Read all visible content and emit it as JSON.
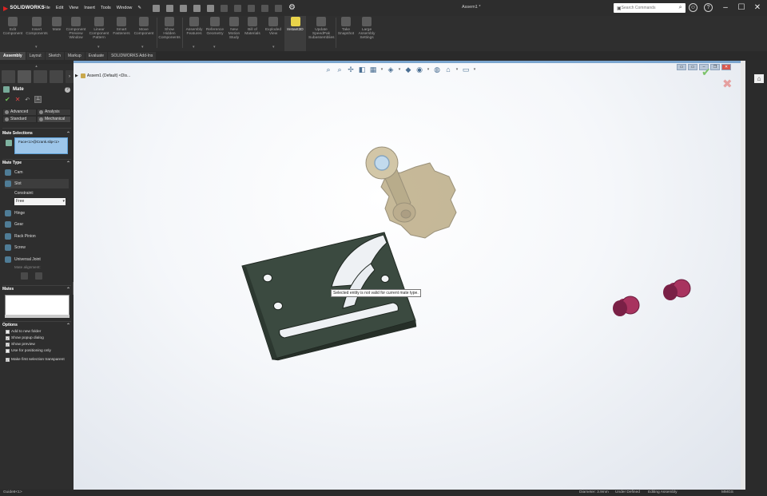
{
  "app": {
    "logo": "SOLIDWORKS",
    "document_title": "Assem1 *"
  },
  "menu": [
    "File",
    "Edit",
    "View",
    "Insert",
    "Tools",
    "Window"
  ],
  "search": {
    "placeholder": "Search Commands"
  },
  "ribbon": [
    {
      "id": "edit-component",
      "label": "Edit Component"
    },
    {
      "id": "insert-components",
      "label": "Insert Components"
    },
    {
      "id": "mate",
      "label": "Mate"
    },
    {
      "id": "component-preview",
      "label": "Component Preview Window"
    },
    {
      "id": "linear-pattern",
      "label": "Linear Component Pattern"
    },
    {
      "id": "smart-fasteners",
      "label": "Smart Fasteners"
    },
    {
      "id": "move-component",
      "label": "Move Component"
    },
    {
      "id": "show-hidden",
      "label": "Show Hidden Components"
    },
    {
      "id": "assembly-features",
      "label": "Assembly Features"
    },
    {
      "id": "reference-geometry",
      "label": "Reference Geometry"
    },
    {
      "id": "new-motion-study",
      "label": "New Motion Study"
    },
    {
      "id": "bill-of-materials",
      "label": "Bill of Materials"
    },
    {
      "id": "exploded-view",
      "label": "Exploded View"
    },
    {
      "id": "instant3d",
      "label": "Instant3D"
    },
    {
      "id": "update-speedpak",
      "label": "Update SpeedPak Subassemblies"
    },
    {
      "id": "take-snapshot",
      "label": "Take Snapshot"
    },
    {
      "id": "large-assembly",
      "label": "Large Assembly Settings"
    }
  ],
  "tabs": [
    "Assembly",
    "Layout",
    "Sketch",
    "Markup",
    "Evaluate",
    "SOLIDWORKS Add-Ins"
  ],
  "pm": {
    "title": "Mate",
    "help": "?",
    "subtabs": [
      "Advanced",
      "Analysis",
      "Standard",
      "Mechanical"
    ],
    "mate_selections_title": "Mate Selections",
    "selection": "Face<1>@Crank.slip<1>",
    "mate_type_title": "Mate Type",
    "mate_types": [
      "Cam",
      "Slot",
      "Hinge",
      "Gear",
      "Rack Pinion",
      "Screw",
      "Universal Joint"
    ],
    "constraint_label": "Constraint:",
    "constraint_value": "Free",
    "mate_alignment_label": "Mate alignment:",
    "mates_title": "Mates",
    "options_title": "Options",
    "options": [
      {
        "label": "Add to new folder",
        "checked": false
      },
      {
        "label": "Show popup dialog",
        "checked": true
      },
      {
        "label": "Show preview",
        "checked": true
      },
      {
        "label": "Use for positioning only",
        "checked": false
      },
      {
        "label": "Make first selection transparent",
        "checked": true
      }
    ]
  },
  "viewport": {
    "tree_label": "Assem1 (Default) <Dis...",
    "tooltip": "Selected entity is not valid for current mate type."
  },
  "status": {
    "left": "Guide8<1>",
    "diameter": "Diameter: 3.9mm",
    "state": "Under Defined",
    "mode": "Editing Assembly",
    "units": "MMGS"
  }
}
